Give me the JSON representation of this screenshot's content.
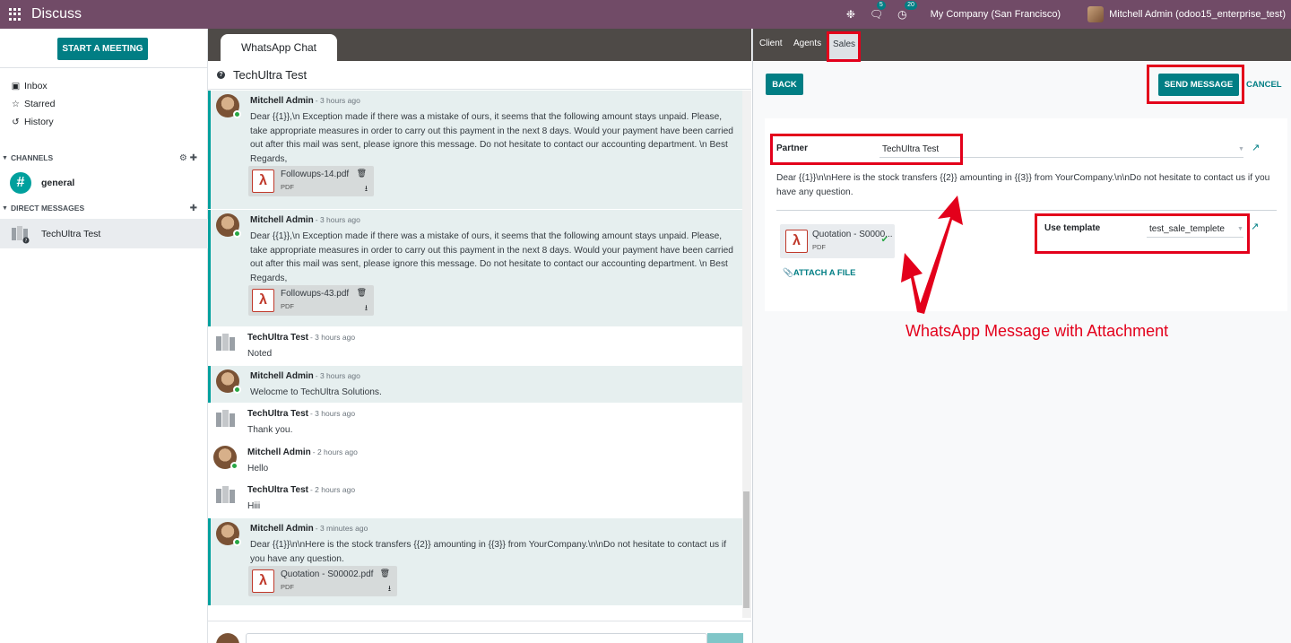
{
  "navbar": {
    "app_title": "Discuss",
    "chat_badge": "5",
    "activity_badge": "20",
    "company": "My Company (San Francisco)",
    "user": "Mitchell Admin (odoo15_enterprise_test)"
  },
  "sidebar": {
    "start_meeting": "START A MEETING",
    "mailboxes": [
      {
        "label": "Inbox",
        "icon": "inbox-icon"
      },
      {
        "label": "Starred",
        "icon": "star-icon"
      },
      {
        "label": "History",
        "icon": "history-icon"
      }
    ],
    "channels_header": "CHANNELS",
    "channel": "general",
    "dm_header": "DIRECT MESSAGES",
    "dm_contact": "TechUltra Test"
  },
  "chat": {
    "tab_label": "WhatsApp Chat",
    "thread_title": "TechUltra Test",
    "messages": [
      {
        "author": "Mitchell Admin",
        "time": "- 3 hours ago",
        "body": "Dear {{1}},\\n Exception made if there was a mistake of ours, it seems that the following amount stays unpaid. Please, take appropriate measures in order to carry out this payment in the next 8 days. Would your payment have been carried out after this mail was sent, please ignore this message. Do not hesitate to contact our accounting department. \\n Best Regards,",
        "attachment": {
          "name": "Followups-14.pdf",
          "type": "PDF"
        }
      },
      {
        "author": "Mitchell Admin",
        "time": "- 3 hours ago",
        "body": "Dear {{1}},\\n Exception made if there was a mistake of ours, it seems that the following amount stays unpaid. Please, take appropriate measures in order to carry out this payment in the next 8 days. Would your payment have been carried out after this mail was sent, please ignore this message. Do not hesitate to contact our accounting department. \\n Best Regards,",
        "attachment": {
          "name": "Followups-43.pdf",
          "type": "PDF"
        }
      },
      {
        "author": "TechUltra Test",
        "time": "- 3 hours ago",
        "body": "Noted"
      },
      {
        "author": "Mitchell Admin",
        "time": "- 3 hours ago",
        "body": "Welocme to TechUltra Solutions."
      },
      {
        "author": "TechUltra Test",
        "time": "- 3 hours ago",
        "body": "Thank you."
      },
      {
        "author": "Mitchell Admin",
        "time": "- 2 hours ago",
        "body": "Hello"
      },
      {
        "author": "TechUltra Test",
        "time": "- 2 hours ago",
        "body": "Hiii"
      },
      {
        "author": "Mitchell Admin",
        "time": "- 3 minutes ago",
        "body": "Dear {{1}}\\n\\nHere is the stock transfers {{2}} amounting in {{3}} from YourCompany.\\n\\nDo not hesitate to contact us if you have any question.",
        "attachment": {
          "name": "Quotation - S00002.pdf",
          "type": "PDF"
        }
      }
    ]
  },
  "panel": {
    "tabs": [
      "Client",
      "Agents",
      "Sales"
    ],
    "active_tab": "Sales",
    "back": "BACK",
    "send": "SEND MESSAGE",
    "cancel": "CANCEL",
    "partner_label": "Partner",
    "partner_value": "TechUltra Test",
    "message_body": "Dear {{1}}\\n\\nHere is the stock transfers {{2}} amounting in {{3}} from YourCompany.\\n\\nDo not hesitate to contact us if you have any question.",
    "attachment_name": "Quotation - S0000...",
    "attachment_type": "PDF",
    "attach_file": "ATTACH A FILE",
    "template_label": "Use template",
    "template_value": "test_sale_templete",
    "caption": "WhatsApp Message with Attachment"
  },
  "colors": {
    "navbar": "#714B67",
    "primary": "#017e84",
    "highlight": "#e3001b"
  }
}
